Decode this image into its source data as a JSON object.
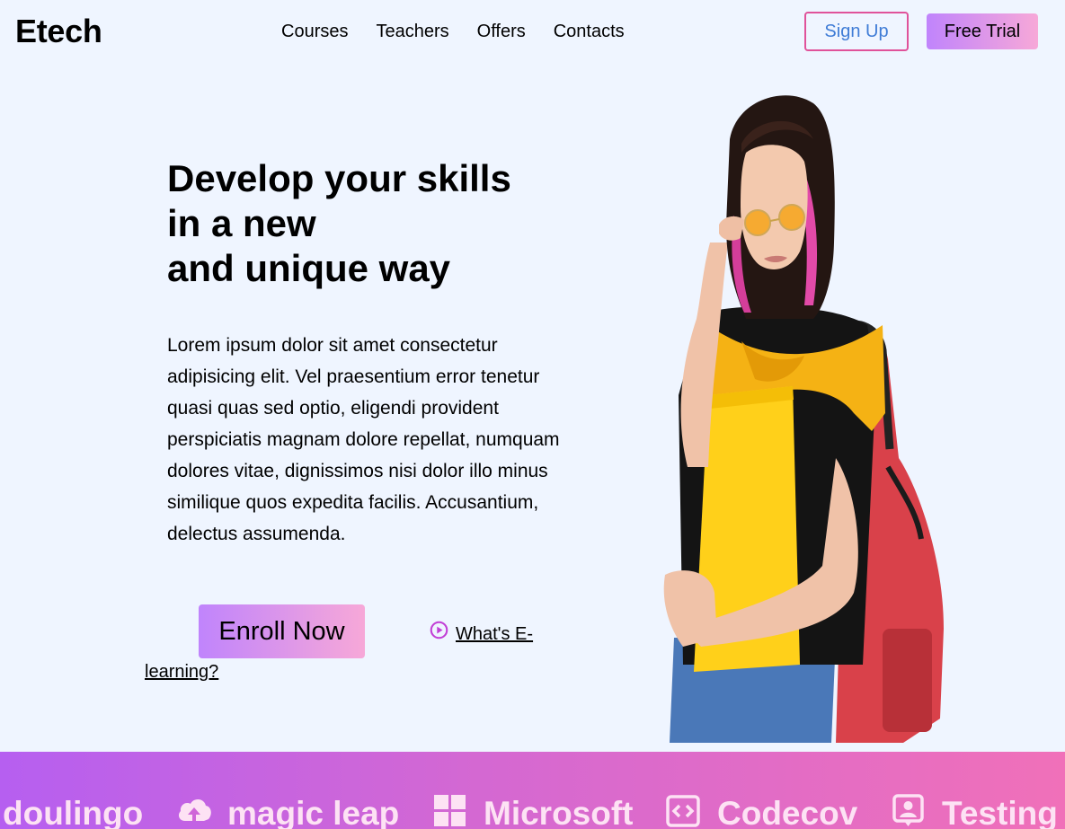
{
  "header": {
    "logo": "Etech",
    "nav": [
      "Courses",
      "Teachers",
      "Offers",
      "Contacts"
    ],
    "signup_label": "Sign Up",
    "trial_label": "Free Trial"
  },
  "hero": {
    "title_lines": [
      "Develop your skills",
      "in a new",
      "and unique way"
    ],
    "paragraph": "Lorem ipsum dolor sit amet consectetur adipisicing elit. Vel praesentium error tenetur quasi quas sed optio, eligendi provident perspiciatis magnam dolore repellat, numquam dolores vitae, dignissimos nisi dolor illo minus similique quos expedita facilis. Accusantium, delectus assumenda.",
    "enroll_label": "Enroll Now",
    "video_link_part1": "What's E-",
    "video_link_part2": "learning?"
  },
  "partners": {
    "items": [
      {
        "name": "doulingo",
        "icon": "none"
      },
      {
        "name": "magic leap",
        "icon": "cloud-upload-icon"
      },
      {
        "name": "Microsoft",
        "icon": "windows-icon"
      },
      {
        "name": "Codecov",
        "icon": "code-icon"
      },
      {
        "name": "Testing",
        "icon": "user-card-icon"
      }
    ]
  },
  "colors": {
    "background": "#eff5ff",
    "accent_pink": "#e0529a",
    "signup_text": "#3f7cd6",
    "gradient_start": "#c084fc",
    "gradient_end": "#f7a8d8",
    "play_icon": "#c23fd6"
  }
}
